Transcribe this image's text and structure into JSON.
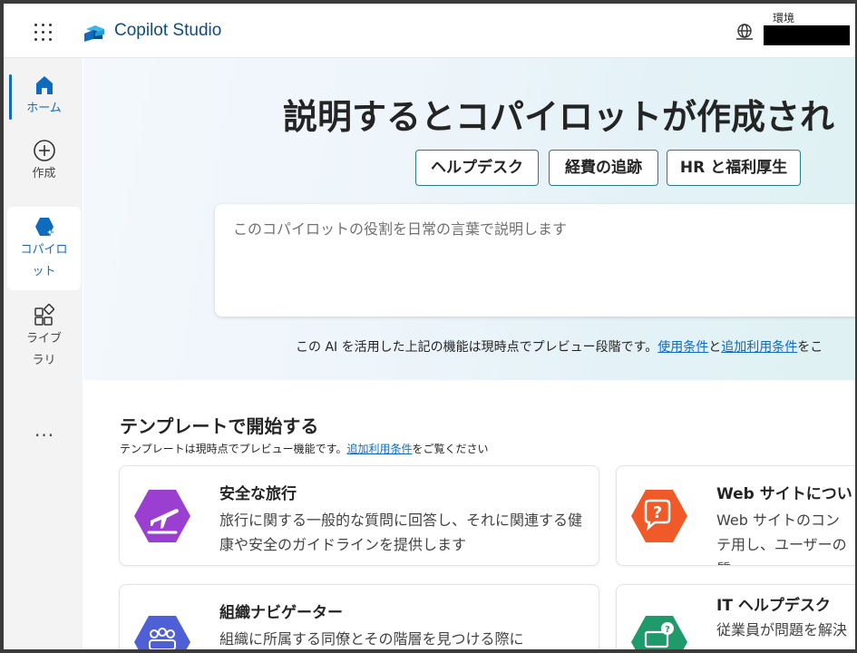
{
  "app": {
    "title": "Copilot Studio"
  },
  "header": {
    "env_label": "環境",
    "env_value": "",
    "icons": [
      "waffle-icon",
      "copilot-studio-logo",
      "globe-icon"
    ]
  },
  "sidebar": {
    "items": [
      {
        "label": "ホーム",
        "icon": "home-icon",
        "active": true
      },
      {
        "label": "作成",
        "icon": "plus-circle-icon"
      },
      {
        "label": "コパイロット",
        "icon": "copilot-icon",
        "selected": true
      },
      {
        "label": "ライブラリ",
        "icon": "library-icon"
      }
    ],
    "more_label": "..."
  },
  "hero": {
    "title": "説明するとコパイロットが作成され",
    "chips": [
      "ヘルプデスク",
      "経費の追跡",
      "HR と福利厚生"
    ],
    "prompt_placeholder": "このコパイロットの役割を日常の言葉で説明します",
    "disclaimer_prefix": "この AI を活用した上記の機能は現時点でプレビュー段階です。",
    "disclaimer_link1": "使用条件",
    "disclaimer_mid": "と",
    "disclaimer_link2": "追加利用条件",
    "disclaimer_suffix": "をこ"
  },
  "templates": {
    "title": "テンプレートで開始する",
    "sub_prefix": "テンプレートは現時点でプレビュー機能です。",
    "sub_link": "追加利用条件",
    "sub_suffix": "をご覧ください",
    "cards": [
      {
        "title": "安全な旅行",
        "desc": "旅行に関する一般的な質問に回答し、それに関連する健康や安全のガイドラインを提供します",
        "icon": "airplane-icon",
        "color": "#9b3fd0"
      },
      {
        "title": "Web サイトについ",
        "desc": "Web サイトのコンテ用し、ユーザーの質",
        "icon": "chat-question-icon",
        "color": "#f05a28"
      },
      {
        "title": "組織ナビゲーター",
        "desc": "組織に所属する同僚とその階層を見つける際に",
        "icon": "people-icon",
        "color": "#4f5fd6"
      },
      {
        "title": "IT ヘルプデスク",
        "desc": "従業員が問題を解決",
        "icon": "laptop-question-icon",
        "color": "#1f9a6b"
      }
    ]
  }
}
